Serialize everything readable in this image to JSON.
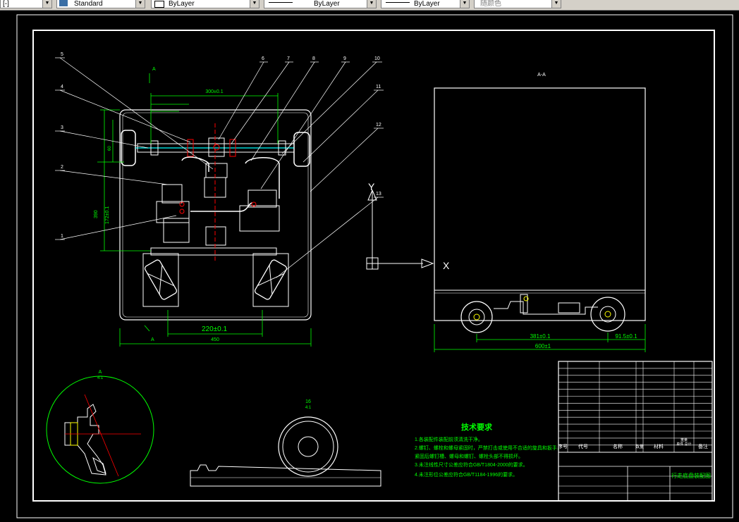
{
  "toolbar": {
    "combo_first": "[-]",
    "text_style": "Standard",
    "layer_color": "ByLayer",
    "linetype": "ByLayer",
    "lineweight": "ByLayer",
    "plot_style": "随颜色"
  },
  "drawing": {
    "view_label": "A-A",
    "section_label_left": "A",
    "section_label_bottom": "A",
    "detail_label": "A",
    "detail_scale": "4:1",
    "detail2_label": "16",
    "detail2_scale": "4:1",
    "dim_top": "300±0.1",
    "dim_width": "450",
    "dim_220": "220±0.1",
    "dim_side_length": "600±1",
    "dim_side_wheelbase": "381±0.1",
    "dim_side_offset": "91.5±0.1",
    "dim_vert_390": "390",
    "dim_vert_172": "172±0.1",
    "dim_vert_small": "60",
    "callouts": [
      "1",
      "2",
      "3",
      "4",
      "5",
      "6",
      "7",
      "8",
      "9",
      "10",
      "11",
      "12",
      "13"
    ],
    "ucs_y": "Y",
    "ucs_x": "X",
    "tech_title": "技术要求",
    "tech_notes": [
      "1.各装配件装配前须清洗干净。",
      "2.螺钉、螺栓和螺母紧固时，严禁打击或使用不合适的旋具和扳手，",
      "  紧固后螺钉槽、螺母和螺钉、螺栓头部不得损坏。",
      "3.未注线性尺寸公差应符合GB/T1804-2000的要求。",
      "4.未注形位公差应符合GB/T1184-1996的要求。"
    ],
    "title_block": {
      "drawing_name": "行走底盘装配图",
      "header_cols": [
        "序号",
        "代号",
        "名称",
        "数量",
        "材料",
        "单件 总计",
        "备注"
      ],
      "header_weight": "重量"
    }
  },
  "colors": {
    "frame": "#ffffff",
    "cyan": "#00ffff",
    "green": "#00ff00",
    "red": "#ff0000",
    "magenta": "#ff00ff",
    "yellow": "#ffff00"
  }
}
